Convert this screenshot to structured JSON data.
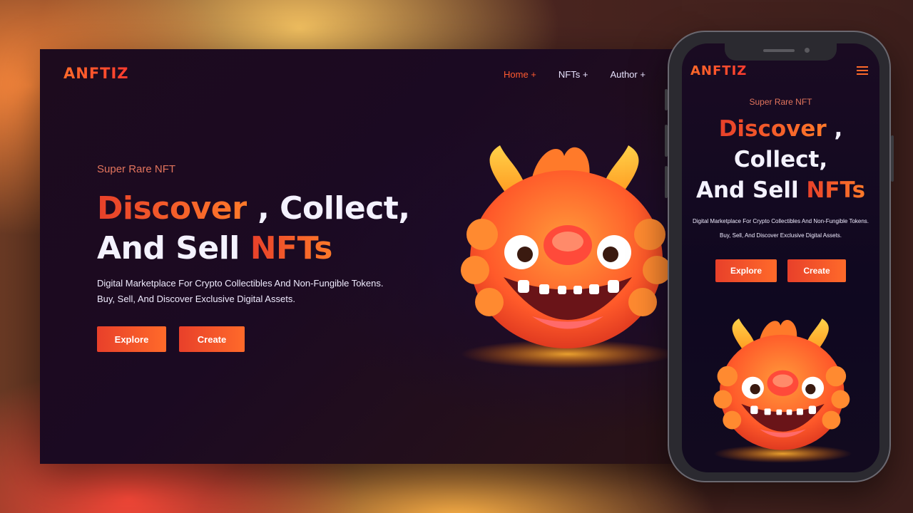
{
  "brand": {
    "logo": "ANFTIZ"
  },
  "nav": [
    {
      "label": "Home +",
      "active": true
    },
    {
      "label": "NFTs +",
      "active": false
    },
    {
      "label": "Author +",
      "active": false
    }
  ],
  "hero": {
    "eyebrow": "Super Rare NFT",
    "headline_part1": "Discover",
    "headline_part2": " , Collect,",
    "headline_part3": "And Sell ",
    "headline_part4": "NFTs",
    "description_line1": "Digital Marketplace For Crypto Collectibles And Non-Fungible Tokens.",
    "description_line2": "Buy, Sell, And Discover Exclusive Digital Assets.",
    "explore_label": "Explore",
    "create_label": "Create"
  },
  "colors": {
    "accent": "#ff5a30",
    "gradient_start": "#e8402a",
    "gradient_end": "#ff7a2a",
    "background_dark": "#1b0a22"
  },
  "icons": {
    "menu": "hamburger-menu-icon",
    "mascot": "fire-dragon-mascot"
  }
}
